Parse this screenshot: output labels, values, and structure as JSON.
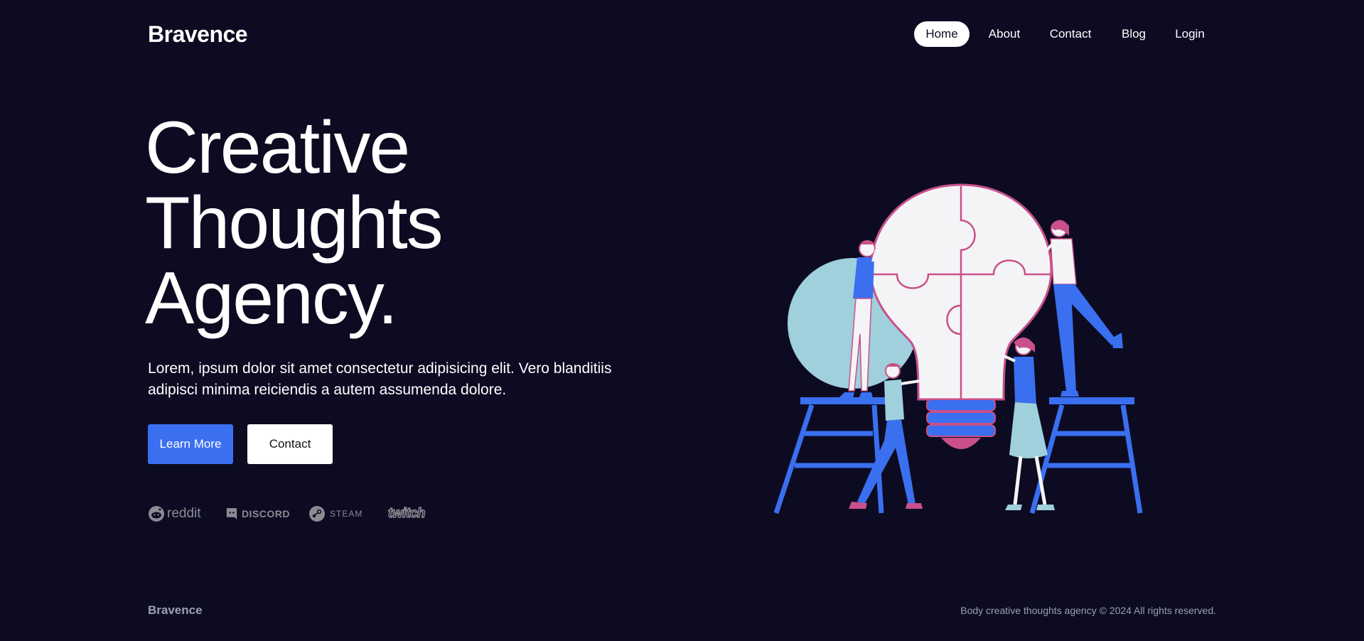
{
  "header": {
    "logo": "Bravence",
    "nav": [
      "Home",
      "About",
      "Contact",
      "Blog",
      "Login"
    ],
    "active_nav": "Home"
  },
  "hero": {
    "headline": [
      "Creative",
      "Thoughts",
      "Agency."
    ],
    "description": "Lorem, ipsum dolor sit amet consectetur adipisicing elit. Vero blanditiis adipisci minima reiciendis a autem assumenda dolore.",
    "primary_button": "Learn More",
    "secondary_button": "Contact"
  },
  "brands": [
    {
      "name": "reddit",
      "icon": "reddit-icon"
    },
    {
      "name": "DISCORD",
      "icon": "discord-icon"
    },
    {
      "name": "STEAM",
      "icon": "steam-icon"
    },
    {
      "name": "twitch",
      "icon": "twitch-icon"
    }
  ],
  "footer": {
    "logo": "Bravence",
    "copyright": "Body creative thoughts agency © 2024 All rights reserved."
  },
  "colors": {
    "background": "#0c0b22",
    "accent": "#3a6ff0",
    "illustration_pink": "#c9508a",
    "illustration_light_blue": "#9fd0dc",
    "muted_text": "#9aa0b4"
  }
}
